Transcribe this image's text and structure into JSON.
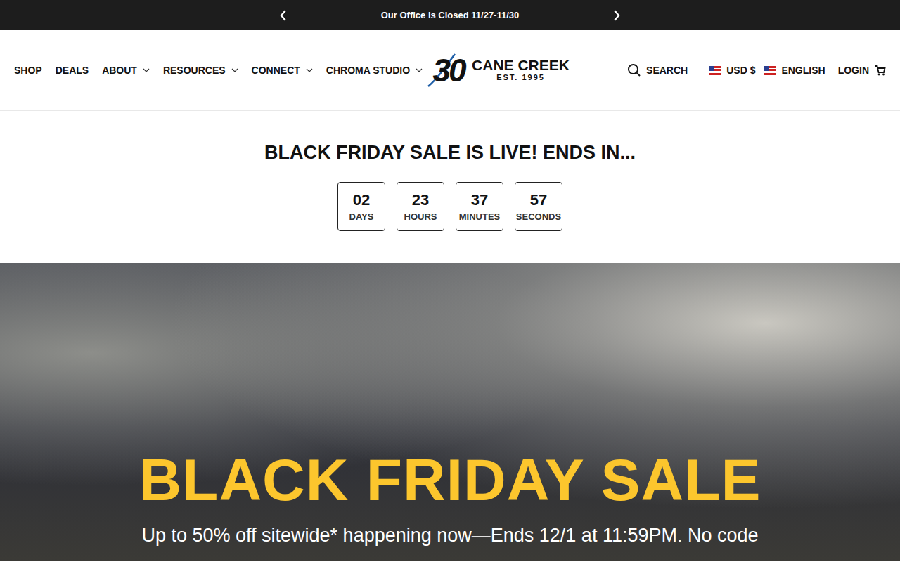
{
  "announcement": {
    "text": "Our Office is Closed 11/27-11/30"
  },
  "nav": [
    {
      "label": "SHOP",
      "has_menu": false
    },
    {
      "label": "DEALS",
      "has_menu": false
    },
    {
      "label": "ABOUT",
      "has_menu": true
    },
    {
      "label": "RESOURCES",
      "has_menu": true
    },
    {
      "label": "CONNECT",
      "has_menu": true
    },
    {
      "label": "CHROMA STUDIO",
      "has_menu": true
    }
  ],
  "logo": {
    "number": "30",
    "name": "CANE CREEK",
    "est": "EST. 1995"
  },
  "utility": {
    "search": "SEARCH",
    "currency": "USD $",
    "language": "ENGLISH",
    "login": "LOGIN"
  },
  "countdown": {
    "heading": "BLACK FRIDAY SALE IS LIVE! ENDS IN...",
    "units": [
      {
        "value": "02",
        "label": "DAYS"
      },
      {
        "value": "23",
        "label": "HOURS"
      },
      {
        "value": "37",
        "label": "MINUTES"
      },
      {
        "value": "57",
        "label": "SECONDS"
      }
    ]
  },
  "hero": {
    "title": "BLACK FRIDAY SALE",
    "subtitle": "Up to 50% off sitewide* happening now—Ends 12/1 at 11:59PM. No code"
  }
}
